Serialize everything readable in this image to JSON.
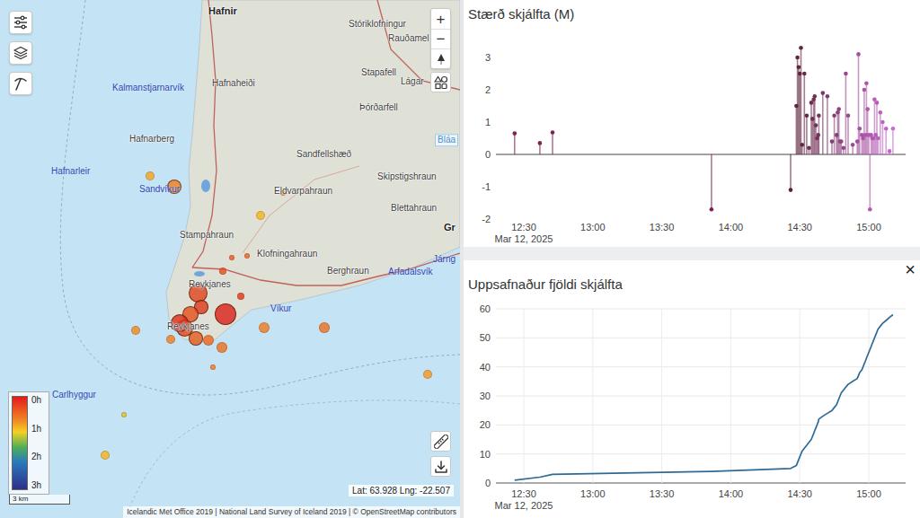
{
  "map": {
    "zoom_in": "+",
    "zoom_out": "−",
    "places": [
      {
        "label": "Hafnir",
        "lat": 63.9558,
        "lng": -22.6144,
        "kind": "town"
      },
      {
        "label": "Stóriklofningur",
        "lat": 63.9506,
        "lng": -22.4896,
        "kind": "land"
      },
      {
        "label": "Rauðamel",
        "lat": 63.945,
        "lng": -22.4544,
        "kind": "land"
      },
      {
        "label": "Hafnaheiði",
        "lat": 63.9275,
        "lng": -22.6112,
        "kind": "land"
      },
      {
        "label": "Stapafell",
        "lat": 63.9317,
        "lng": -22.4784,
        "kind": "land"
      },
      {
        "label": "Lágar",
        "lat": 63.9282,
        "lng": -22.4432,
        "kind": "land"
      },
      {
        "label": "Kalmanstjarnarvík",
        "lat": 63.9257,
        "lng": -22.7,
        "kind": "water"
      },
      {
        "label": "Þórðarfell",
        "lat": 63.918,
        "lng": -22.48,
        "kind": "land"
      },
      {
        "label": "Hafnarberg",
        "lat": 63.9058,
        "lng": -22.6848,
        "kind": "land"
      },
      {
        "label": "Hafnarleir",
        "lat": 63.8932,
        "lng": -22.7544,
        "kind": "water"
      },
      {
        "label": "Sandfellshæð",
        "lat": 63.8998,
        "lng": -22.536,
        "kind": "land"
      },
      {
        "label": "Bláa",
        "lat": 63.9054,
        "lng": -22.4128,
        "kind": "poi"
      },
      {
        "label": "Skipstigshraun",
        "lat": 63.891,
        "lng": -22.464,
        "kind": "land"
      },
      {
        "label": "Sandvíkur",
        "lat": 63.8862,
        "lng": -22.676,
        "kind": "water"
      },
      {
        "label": "Eldvarpahraun",
        "lat": 63.8855,
        "lng": -22.556,
        "kind": "land"
      },
      {
        "label": "Blettahraun",
        "lat": 63.8788,
        "lng": -22.452,
        "kind": "land"
      },
      {
        "label": "Gr",
        "lat": 63.8715,
        "lng": -22.4048,
        "kind": "town"
      },
      {
        "label": "Stampahraun",
        "lat": 63.8683,
        "lng": -22.64,
        "kind": "land"
      },
      {
        "label": "Klofningahraun",
        "lat": 63.861,
        "lng": -22.5712,
        "kind": "land"
      },
      {
        "label": "Berghraun",
        "lat": 63.8543,
        "lng": -22.5088,
        "kind": "land"
      },
      {
        "label": "Járng",
        "lat": 63.8589,
        "lng": -22.4144,
        "kind": "water"
      },
      {
        "label": "Arfadalsvík",
        "lat": 63.8539,
        "lng": -22.4544,
        "kind": "water"
      },
      {
        "label": "Reykjanes",
        "lat": 63.849,
        "lng": -22.632,
        "kind": "land"
      },
      {
        "label": "Víkur",
        "lat": 63.8396,
        "lng": -22.5592,
        "kind": "water"
      },
      {
        "label": "Reykjanes",
        "lat": 63.8326,
        "lng": -22.6512,
        "kind": "land"
      },
      {
        "label": "Carlhyggur",
        "lat": 63.806,
        "lng": -22.7536,
        "kind": "water"
      }
    ],
    "earthquakes": [
      {
        "lat": 63.8872,
        "lng": -22.6448,
        "magnitude": 1.6,
        "hours_ago": 0.9
      },
      {
        "lat": 63.8914,
        "lng": -22.6664,
        "magnitude": 0.5,
        "hours_ago": 1.2
      },
      {
        "lat": 63.876,
        "lng": -22.568,
        "magnitude": 0.5,
        "hours_ago": 1.3
      },
      {
        "lat": 63.8848,
        "lng": -22.548,
        "magnitude": -0.3,
        "hours_ago": 1.0
      },
      {
        "lat": 63.8603,
        "lng": -22.58,
        "magnitude": -0.3,
        "hours_ago": 0.7
      },
      {
        "lat": 63.8596,
        "lng": -22.5936,
        "magnitude": -0.3,
        "hours_ago": 0.6
      },
      {
        "lat": 63.8543,
        "lng": -22.6016,
        "magnitude": 0.1,
        "hours_ago": 0.5
      },
      {
        "lat": 63.8459,
        "lng": -22.624,
        "magnitude": 2.6,
        "hours_ago": 0.4
      },
      {
        "lat": 63.8403,
        "lng": -22.6208,
        "magnitude": 1.5,
        "hours_ago": 0.3
      },
      {
        "lat": 63.8375,
        "lng": -22.6304,
        "magnitude": 1.9,
        "hours_ago": 0.5
      },
      {
        "lat": 63.8322,
        "lng": -22.636,
        "magnitude": 2.2,
        "hours_ago": 0.4
      },
      {
        "lat": 63.828,
        "lng": -22.6256,
        "magnitude": 1.5,
        "hours_ago": 0.6
      },
      {
        "lat": 63.8274,
        "lng": -22.6144,
        "magnitude": 0.8,
        "hours_ago": 0.7
      },
      {
        "lat": 63.8245,
        "lng": -22.6024,
        "magnitude": 0.7,
        "hours_ago": 0.8
      },
      {
        "lat": 63.8277,
        "lng": -22.648,
        "magnitude": 0.4,
        "hours_ago": 0.9
      },
      {
        "lat": 63.8312,
        "lng": -22.6792,
        "magnitude": 0.4,
        "hours_ago": 1.0
      },
      {
        "lat": 63.8323,
        "lng": -22.5648,
        "magnitude": 0.8,
        "hours_ago": 0.9
      },
      {
        "lat": 63.8323,
        "lng": -22.5112,
        "magnitude": 0.7,
        "hours_ago": 0.8
      },
      {
        "lat": 63.8445,
        "lng": -22.5856,
        "magnitude": 0.1,
        "hours_ago": 0.3
      },
      {
        "lat": 63.8169,
        "lng": -22.6104,
        "magnitude": -0.5,
        "hours_ago": 0.9
      },
      {
        "lat": 63.814,
        "lng": -22.4192,
        "magnitude": 0.5,
        "hours_ago": 1.1
      },
      {
        "lat": 63.7983,
        "lng": -22.6896,
        "magnitude": -0.5,
        "hours_ago": 1.6
      },
      {
        "lat": 63.7826,
        "lng": -22.7064,
        "magnitude": 0.5,
        "hours_ago": 1.3
      },
      {
        "lat": 63.834,
        "lng": -22.64,
        "magnitude": 2.4,
        "hours_ago": 0.2
      },
      {
        "lat": 63.8375,
        "lng": -22.5992,
        "magnitude": 3.3,
        "hours_ago": 0.1
      }
    ],
    "legend": [
      "0h",
      "1h",
      "2h",
      "3h"
    ],
    "scale": "3 km",
    "cursor": "Lat: 63.928 Lng: -22.507",
    "attribution": "Icelandic Met Office 2019 | National Land Survey of Iceland 2019 | © OpenStreetMap contributors"
  },
  "magnitude_chart": {
    "title": "Stærð skjálfta (M)",
    "y_ticks": [
      "3",
      "2",
      "1",
      "0",
      "-1",
      "-2"
    ],
    "x_ticks": [
      "12:30",
      "13:00",
      "13:30",
      "14:00",
      "14:30",
      "15:00"
    ],
    "date": "Mar 12, 2025"
  },
  "count_chart": {
    "title": "Uppsafnaður fjöldi skjálfta",
    "y_ticks": [
      "60",
      "50",
      "40",
      "30",
      "20",
      "10",
      "0"
    ],
    "x_ticks": [
      "12:30",
      "13:00",
      "13:30",
      "14:00",
      "14:30",
      "15:00"
    ],
    "date": "Mar 12, 2025",
    "close": "×"
  },
  "events": {
    "minutes_after_noon": [
      26,
      37,
      42.5,
      111.6,
      146,
      148.5,
      149,
      149.5,
      150,
      150.5,
      151,
      152,
      153,
      154,
      155,
      155.5,
      156,
      156.5,
      157,
      157.5,
      158,
      158.3,
      160,
      162,
      164,
      165,
      166,
      166.5,
      167,
      167.5,
      168,
      169,
      170,
      171,
      173,
      175,
      175.5,
      176,
      177,
      177.5,
      178,
      178.5,
      179,
      179.5,
      180,
      180.5,
      181,
      181.5,
      182,
      182.5,
      183,
      183.5,
      184,
      185,
      186,
      187.5,
      189,
      190.5
    ],
    "magnitude": [
      0.65,
      0.35,
      0.68,
      -1.7,
      -1.1,
      1.5,
      3.0,
      2.7,
      2.5,
      3.3,
      0.3,
      2.5,
      1.2,
      0.2,
      1.6,
      1.1,
      1.7,
      1.8,
      0.9,
      0.5,
      0.6,
      1.2,
      1.9,
      1.8,
      0.4,
      1.2,
      0.6,
      1.3,
      1.4,
      0.4,
      0.4,
      0.2,
      2.5,
      1.2,
      0.3,
      0.4,
      3.1,
      0.8,
      0.6,
      0.5,
      2.0,
      0.6,
      2.2,
      1.4,
      0.6,
      -1.7,
      0.6,
      0.5,
      0.5,
      1.7,
      0.6,
      1.6,
      0.5,
      1.3,
      1.0,
      0.8,
      0.1,
      0.8
    ]
  }
}
